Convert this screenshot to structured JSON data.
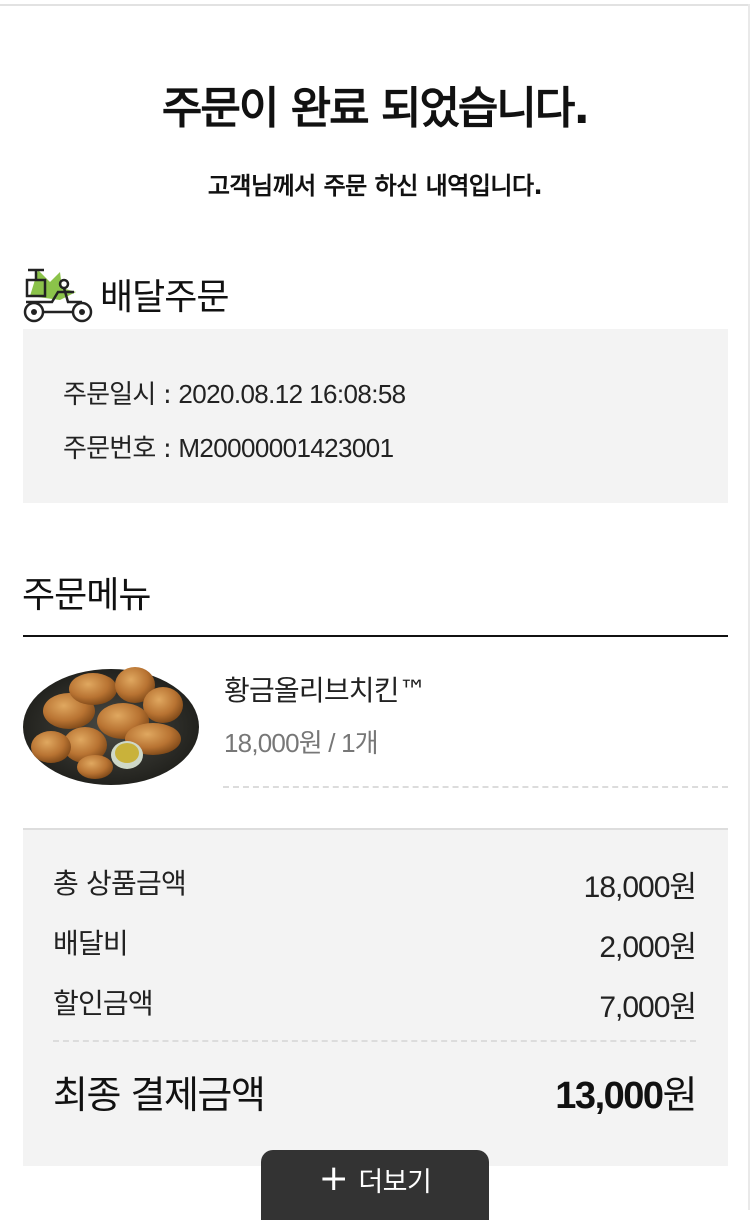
{
  "page": {
    "title": "주문이 완료 되었습니다.",
    "subtitle": "고객님께서 주문 하신 내역입니다."
  },
  "delivery": {
    "icon": "delivery-bike-icon",
    "label": "배달주문"
  },
  "order_info": {
    "date_label": "주문일시 :",
    "date_value": "2020.08.12 16:08:58",
    "number_label": "주문번호 :",
    "number_value": "M20000001423001"
  },
  "menu": {
    "heading": "주문메뉴",
    "items": [
      {
        "name": "황금올리브치킨™",
        "price": "18,000원 / 1개",
        "image": "fried-chicken-image"
      }
    ]
  },
  "summary": {
    "rows": [
      {
        "label": "총 상품금액",
        "amount": "18,000원"
      },
      {
        "label": "배달비",
        "amount": "2,000원"
      },
      {
        "label": "할인금액",
        "amount": "7,000원"
      }
    ],
    "final_label": "최종 결제금액",
    "final_amount": "13,000",
    "final_unit": "원"
  },
  "more_button": {
    "icon": "plus-icon",
    "label": "더보기"
  },
  "colors": {
    "accent_green": "#8bc34a",
    "panel_bg": "#f3f3f3",
    "button_bg": "#333333"
  }
}
